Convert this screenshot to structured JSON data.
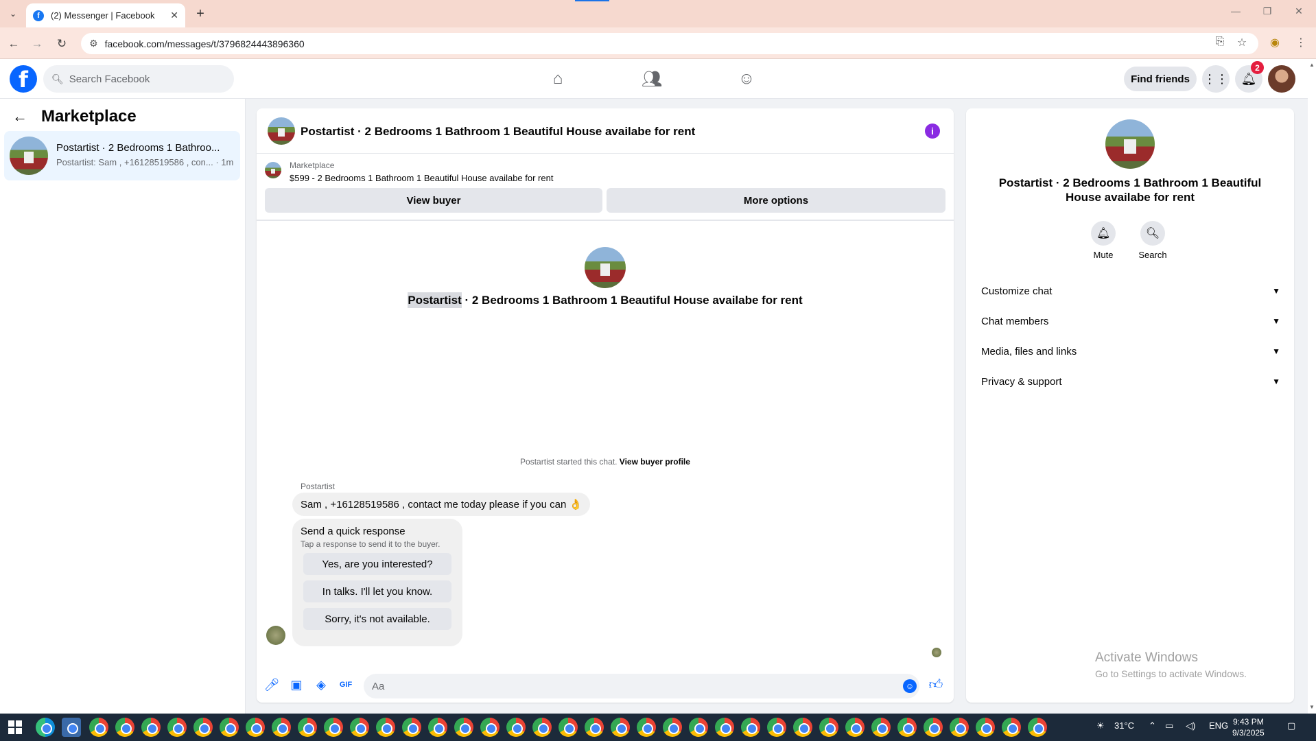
{
  "browser": {
    "tab_title": "(2) Messenger | Facebook",
    "url": "facebook.com/messages/t/3796824443896360"
  },
  "header": {
    "search_placeholder": "Search Facebook",
    "find_friends": "Find friends",
    "notifications_count": "2"
  },
  "sidebar": {
    "title": "Marketplace",
    "items": [
      {
        "title": "Postartist · 2 Bedrooms 1 Bathroo...",
        "preview": "Postartist: Sam , +16128519586 , con... · 1m"
      }
    ]
  },
  "chat": {
    "title": "Postartist · 2 Bedrooms 1 Bathroom 1 Beautiful House availabe for rent",
    "marketplace_label": "Marketplace",
    "listing": "$599 - 2 Bedrooms 1 Bathroom 1 Beautiful House availabe for rent",
    "view_buyer": "View buyer",
    "more_options": "More options",
    "intro_highlight": "Postartist",
    "intro_rest": " · 2 Bedrooms 1 Bathroom 1 Beautiful House availabe for rent",
    "started_text": "Postartist started this chat.",
    "view_buyer_profile": "View buyer profile",
    "sender": "Postartist",
    "message": "Sam , +16128519586 , contact me today please if you can 👌",
    "quick_title": "Send a quick response",
    "quick_subtitle": "Tap a response to send it to the buyer.",
    "quick_responses": [
      "Yes, are you interested?",
      "In talks. I'll let you know.",
      "Sorry, it's not available."
    ],
    "composer_placeholder": "Aa"
  },
  "right_panel": {
    "name": "Postartist · 2 Bedrooms 1 Bathroom 1 Beautiful House availabe for rent",
    "mute": "Mute",
    "search": "Search",
    "sections": [
      "Customize chat",
      "Chat members",
      "Media, files and links",
      "Privacy & support"
    ]
  },
  "watermark": {
    "line1": "Activate Windows",
    "line2": "Go to Settings to activate Windows."
  },
  "taskbar": {
    "temperature": "31°C",
    "language": "ENG",
    "time": "9:43 PM",
    "date": "9/3/2025"
  }
}
